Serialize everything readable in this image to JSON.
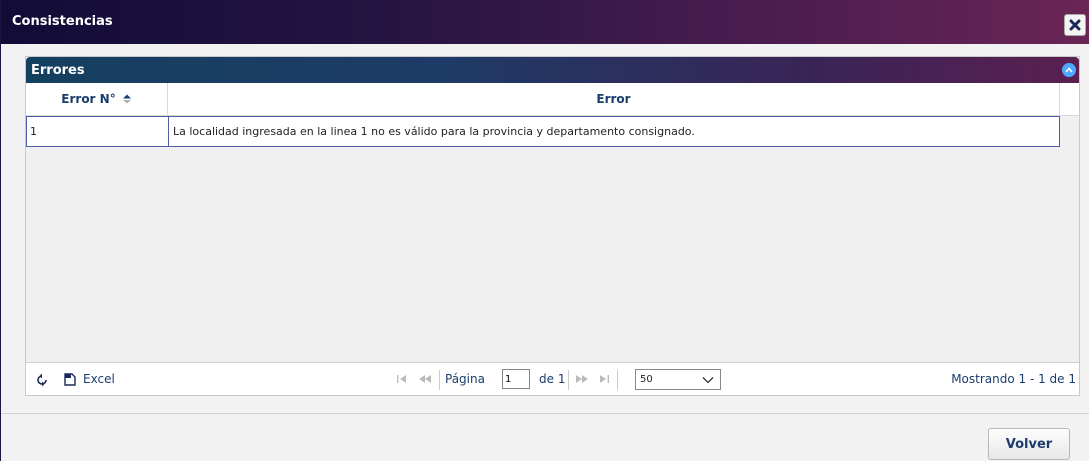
{
  "dialog": {
    "title": "Consistencias",
    "close_icon": "close-icon"
  },
  "panel": {
    "title": "Errores",
    "collapse_icon": "chevron-up-icon",
    "columns": [
      "Error N°",
      "Error"
    ],
    "sort_icon": "sort-asc-icon",
    "rows": [
      {
        "num": "1",
        "error": "La localidad ingresada  en la linea 1 no es válido para la provincia y departamento consignado."
      }
    ]
  },
  "pager": {
    "refresh_icon": "refresh-icon",
    "excel_icon": "document-icon",
    "excel_label": "Excel",
    "page_label": "Página",
    "page_value": "1",
    "of_label": "de 1",
    "page_size": "50",
    "info": "Mostrando 1 - 1 de 1"
  },
  "footer": {
    "back_label": "Volver"
  },
  "colors": {
    "title_gradient_start": "#120c37",
    "title_gradient_end": "#6b2456",
    "panel_header_start": "#144060",
    "panel_header_end": "#5a2050",
    "selected_row_border": "#4e5ea5",
    "link_text": "#1a3d6d"
  }
}
